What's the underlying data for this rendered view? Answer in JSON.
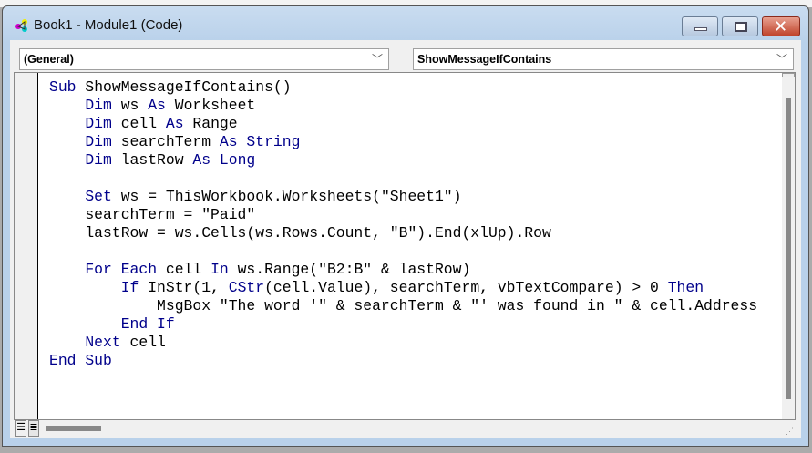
{
  "window": {
    "title": "Book1 - Module1 (Code)",
    "minimize": "—",
    "maximize": "□",
    "close": "✕"
  },
  "dropdowns": {
    "object": "(General)",
    "procedure": "ShowMessageIfContains",
    "chevron": "﹀"
  },
  "code": {
    "lines": [
      [
        [
          "Sub ",
          "kw"
        ],
        [
          "ShowMessageIfContains()",
          ""
        ]
      ],
      [
        [
          "    Dim ",
          "kw"
        ],
        [
          "ws ",
          ""
        ],
        [
          "As ",
          "kw"
        ],
        [
          "Worksheet",
          ""
        ]
      ],
      [
        [
          "    Dim ",
          "kw"
        ],
        [
          "cell ",
          ""
        ],
        [
          "As ",
          "kw"
        ],
        [
          "Range",
          ""
        ]
      ],
      [
        [
          "    Dim ",
          "kw"
        ],
        [
          "searchTerm ",
          ""
        ],
        [
          "As String",
          "kw"
        ]
      ],
      [
        [
          "    Dim ",
          "kw"
        ],
        [
          "lastRow ",
          ""
        ],
        [
          "As Long",
          "kw"
        ]
      ],
      [
        [
          "",
          ""
        ]
      ],
      [
        [
          "    Set ",
          "kw"
        ],
        [
          "ws = ThisWorkbook.Worksheets(\"Sheet1\")",
          ""
        ]
      ],
      [
        [
          "    searchTerm = \"Paid\"",
          ""
        ]
      ],
      [
        [
          "    lastRow = ws.Cells(ws.Rows.Count, \"B\").End(xlUp).Row",
          ""
        ]
      ],
      [
        [
          "",
          ""
        ]
      ],
      [
        [
          "    For Each ",
          "kw"
        ],
        [
          "cell ",
          ""
        ],
        [
          "In ",
          "kw"
        ],
        [
          "ws.Range(\"B2:B\" & lastRow)",
          ""
        ]
      ],
      [
        [
          "        If ",
          "kw"
        ],
        [
          "InStr(1, ",
          ""
        ],
        [
          "CStr",
          "kw"
        ],
        [
          "(cell.Value), searchTerm, vbTextCompare) > 0 ",
          ""
        ],
        [
          "Then",
          "kw"
        ]
      ],
      [
        [
          "            MsgBox \"The word '\" & searchTerm & \"' was found in \" & cell.Address",
          ""
        ]
      ],
      [
        [
          "        End If",
          "kw"
        ]
      ],
      [
        [
          "    Next ",
          "kw"
        ],
        [
          "cell",
          ""
        ]
      ],
      [
        [
          "End Sub",
          "kw"
        ]
      ]
    ]
  },
  "view_buttons": {
    "procedure_view": "☰",
    "module_view": "≣"
  }
}
